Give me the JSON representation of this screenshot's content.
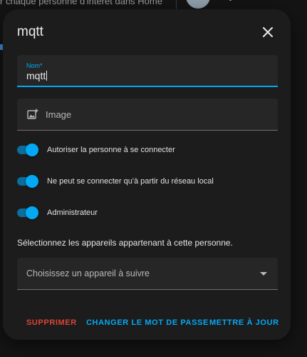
{
  "background": {
    "text": "r chaque personne d'intérêt dans Home"
  },
  "dialog": {
    "title": "mqtt",
    "close_icon": "close-icon"
  },
  "name_field": {
    "label": "Nom*",
    "value": "mqtt"
  },
  "image_field": {
    "icon": "image-plus-icon",
    "label": "Image"
  },
  "switches": [
    {
      "label": "Autoriser la personne à se connecter",
      "checked": true
    },
    {
      "label": "Ne peut se connecter qu'à partir du réseau local",
      "checked": true
    },
    {
      "label": "Administrateur",
      "checked": true
    }
  ],
  "devices": {
    "heading": "Sélectionnez les appareils appartenant à cette personne.",
    "placeholder": "Choisissez un appareil à suivre",
    "arrow_icon": "dropdown-arrow-icon"
  },
  "actions": {
    "delete": "SUPPRIMER",
    "change_password": "CHANGER LE MOT DE PASSE",
    "update": "METTRE À JOUR"
  },
  "colors": {
    "accent": "#03a9f4",
    "danger": "#db4437",
    "dialog_bg": "#1c1c1c",
    "field_bg": "#262626"
  }
}
